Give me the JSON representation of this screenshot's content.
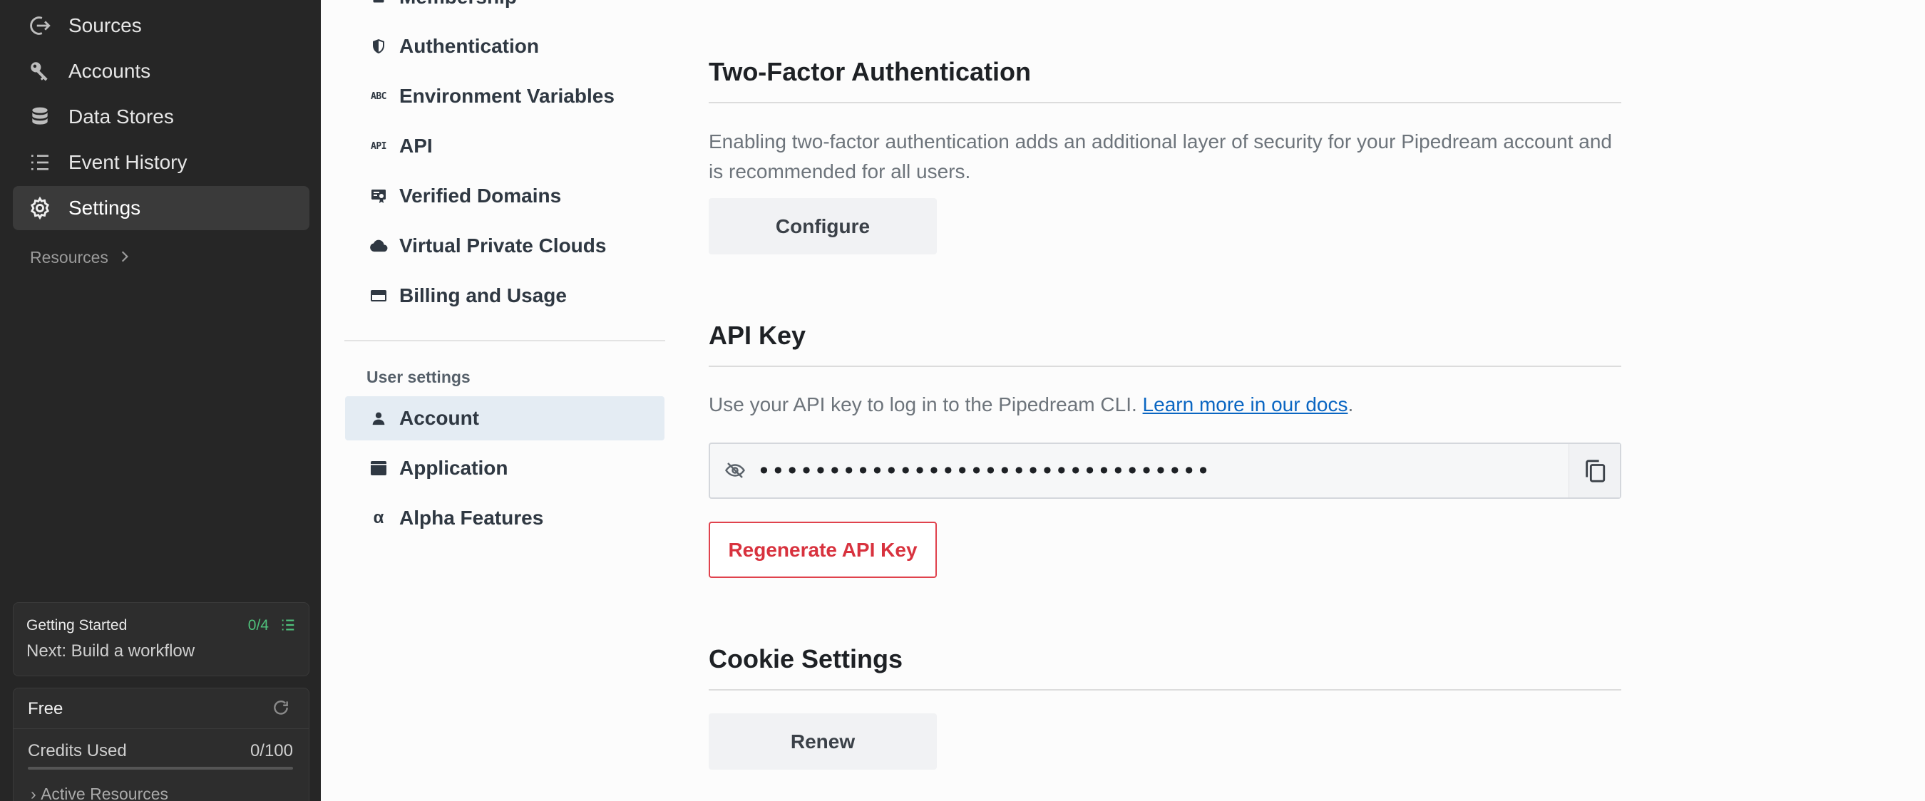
{
  "sidebar": {
    "items": [
      {
        "label": "Sources",
        "icon": "sources-icon",
        "active": false
      },
      {
        "label": "Accounts",
        "icon": "key-icon",
        "active": false
      },
      {
        "label": "Data Stores",
        "icon": "database-icon",
        "active": false
      },
      {
        "label": "Event History",
        "icon": "list-icon",
        "active": false
      },
      {
        "label": "Settings",
        "icon": "gear-icon",
        "active": true
      }
    ],
    "resources_label": "Resources",
    "getting_started": {
      "title": "Getting Started",
      "progress": "0/4",
      "next": "Next: Build a workflow"
    },
    "plan": {
      "name": "Free",
      "credits_label": "Credits Used",
      "credits_value": "0/100",
      "credits_fraction": 0,
      "active_resources_label": "Active Resources"
    }
  },
  "settings_nav": {
    "items": [
      {
        "label": "Membership",
        "icon": "membership-icon"
      },
      {
        "label": "Authentication",
        "icon": "shield-icon"
      },
      {
        "label": "Environment Variables",
        "icon": "abc-icon"
      },
      {
        "label": "API",
        "icon": "api-icon"
      },
      {
        "label": "Verified Domains",
        "icon": "certificate-icon"
      },
      {
        "label": "Virtual Private Clouds",
        "icon": "cloud-icon"
      },
      {
        "label": "Billing and Usage",
        "icon": "credit-card-icon"
      }
    ],
    "user_heading": "User settings",
    "user_items": [
      {
        "label": "Account",
        "icon": "person-icon",
        "active": true
      },
      {
        "label": "Application",
        "icon": "window-icon",
        "active": false
      },
      {
        "label": "Alpha Features",
        "icon": "alpha-icon",
        "active": false
      }
    ]
  },
  "main": {
    "two_factor": {
      "title": "Two-Factor Authentication",
      "description": "Enabling two-factor authentication adds an additional layer of security for your Pipedream account and is recommended for all users.",
      "button": "Configure"
    },
    "api_key": {
      "title": "API Key",
      "description_prefix": "Use your API key to log in to the Pipedream CLI. ",
      "docs_link": "Learn more in our docs",
      "description_suffix": ".",
      "masked_value": "••••••••••••••••••••••••••••••••",
      "regenerate_button": "Regenerate API Key"
    },
    "cookies": {
      "title": "Cookie Settings",
      "button": "Renew"
    }
  },
  "colors": {
    "sidebar_bg": "#262626",
    "active_subnav_bg": "#e4ecf3",
    "link": "#0a66c2",
    "danger": "#d8323e",
    "progress_green": "#4fc27c"
  }
}
